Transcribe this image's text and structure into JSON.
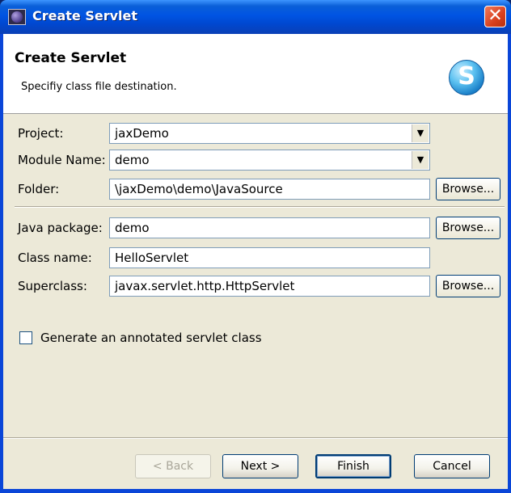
{
  "window": {
    "title": "Create Servlet",
    "close_glyph": "✕",
    "icon": "eclipse-icon"
  },
  "header": {
    "title": "Create Servlet",
    "description": "Specifiy class file destination.",
    "logo_letter": "S"
  },
  "form": {
    "project": {
      "label": "Project:",
      "value": "jaxDemo"
    },
    "module": {
      "label": "Module Name:",
      "value": "demo"
    },
    "folder": {
      "label": "Folder:",
      "value": "\\jaxDemo\\demo\\JavaSource"
    },
    "package": {
      "label": "Java package:",
      "value": "demo"
    },
    "class_name": {
      "label": "Class name:",
      "value": "HelloServlet"
    },
    "superclass": {
      "label": "Superclass:",
      "value": "javax.servlet.http.HttpServlet"
    },
    "browse_label": "Browse...",
    "annotated_checkbox": {
      "label": "Generate an annotated servlet class",
      "checked": false
    }
  },
  "buttons": {
    "back": "< Back",
    "next": "Next >",
    "finish": "Finish",
    "cancel": "Cancel"
  },
  "colors": {
    "titlebar": "#0054e3",
    "dialog_bg": "#ece9d8",
    "field_border": "#7f9db9",
    "button_border": "#003c74"
  }
}
